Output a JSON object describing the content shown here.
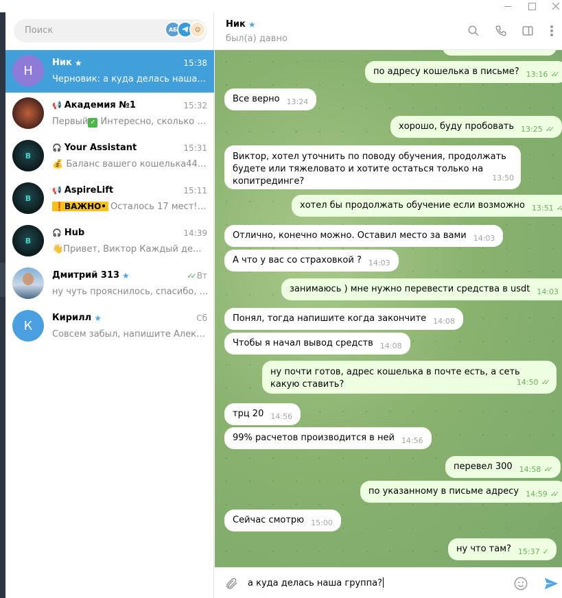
{
  "window": {
    "controls": [
      "minimize",
      "maximize",
      "close"
    ]
  },
  "sidebar": {
    "search_placeholder": "Поиск",
    "search_chips": [
      "АБ",
      "",
      ""
    ],
    "chats": [
      {
        "name": "Ник",
        "verified": true,
        "time": "15:38",
        "preview": "Черновик: а куда делась наша гру...",
        "avatar_letter": "Н",
        "active": true
      },
      {
        "name": "Академия №1",
        "channel": true,
        "time": "15:32",
        "preview": "Первый",
        "preview_rest": "  Интересно, сколько л..."
      },
      {
        "name": "Your Assistant",
        "bot": true,
        "time": "15:31",
        "preview": "💰 Баланс вашего кошелька4445,3..."
      },
      {
        "name": "AspireLift",
        "channel": true,
        "time": "15:11",
        "badge": "❗ВАЖНО•",
        "preview": "Осталось 17 мест! ..."
      },
      {
        "name": "Hub",
        "bot": true,
        "time": "14:39",
        "preview": "👋Привет, Виктор  Каждый де..."
      },
      {
        "name": "Дмитрий 313",
        "verified": true,
        "time": "Вт",
        "read": true,
        "preview": "ну чуть прояснилось, спасибо, над..."
      },
      {
        "name": "Кирилл",
        "verified": true,
        "time": "Сб",
        "preview": "Совсем забыл, напишите Александ...",
        "avatar_letter": "К"
      }
    ]
  },
  "header": {
    "name": "Ник",
    "status": "был(а) давно"
  },
  "messages": [
    {
      "dir": "out",
      "text": "по адресу кошелька в письме?",
      "time": "13:16"
    },
    {
      "dir": "in",
      "text": "Все верно",
      "time": "13:24"
    },
    {
      "dir": "out",
      "text": "хорошо, буду пробовать",
      "time": "13:25"
    },
    {
      "dir": "in",
      "text": "Виктор, хотел уточнить по поводу обучения, продолжать будете или тяжеловато и хотите остаться только на копитрединге?",
      "time": "13:50"
    },
    {
      "dir": "out",
      "text": "хотел бы продолжать обучение если возможно",
      "time": "13:51"
    },
    {
      "dir": "in",
      "text": "Отлично, конечно можно. Оставил место за вами",
      "time": "14:03"
    },
    {
      "dir": "in",
      "text": "А что у вас со страховкой ?",
      "time": "14:03"
    },
    {
      "dir": "out",
      "text": "занимаюсь ) мне нужно перевести средства в usdt",
      "time": "14:03"
    },
    {
      "dir": "in",
      "text": "Понял, тогда напишите когда закончите",
      "time": "14:08"
    },
    {
      "dir": "in",
      "text": "Чтобы я начал вывод средств",
      "time": "14:08"
    },
    {
      "dir": "out",
      "text": "ну почти готов, адрес кошелька в почте есть, а сеть какую ставить?",
      "time": "14:50"
    },
    {
      "dir": "in",
      "text": "трц 20",
      "time": "14:56"
    },
    {
      "dir": "in",
      "text": "99% расчетов производится в ней",
      "time": "14:56"
    },
    {
      "dir": "out",
      "text": "перевел 300",
      "time": "14:58"
    },
    {
      "dir": "out",
      "text": "по указанному в письме адресу",
      "time": "14:59"
    },
    {
      "dir": "in",
      "text": "Сейчас смотрю",
      "time": "15:00"
    },
    {
      "dir": "out",
      "text": "ну что там?",
      "time": "15:37"
    }
  ],
  "composer": {
    "draft": "а куда делась наша группа?"
  },
  "colors": {
    "accent": "#419fd9",
    "outgoing_bubble": "#eefee0",
    "incoming_bubble": "#ffffff",
    "tick_green": "#6cb15d"
  }
}
